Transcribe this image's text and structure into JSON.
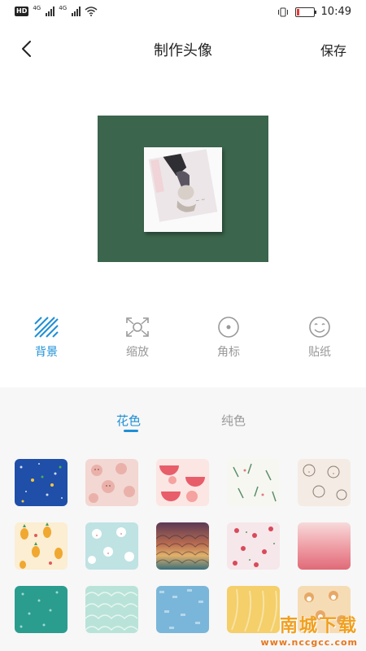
{
  "status_bar": {
    "hd_badge": "HD",
    "signal_1": "4G",
    "signal_2": "4G",
    "time": "10:49"
  },
  "header": {
    "title": "制作头像",
    "save_label": "保存"
  },
  "tools": [
    {
      "label": "背景",
      "icon": "background-stripes-icon",
      "active": true
    },
    {
      "label": "缩放",
      "icon": "scale-icon",
      "active": false
    },
    {
      "label": "角标",
      "icon": "badge-icon",
      "active": false
    },
    {
      "label": "贴纸",
      "icon": "sticker-icon",
      "active": false
    }
  ],
  "subtabs": [
    {
      "label": "花色",
      "active": true
    },
    {
      "label": "纯色",
      "active": false
    }
  ],
  "patterns": [
    {
      "name": "blue-star-pattern",
      "color": "#1f4fa8"
    },
    {
      "name": "pink-bear-pattern",
      "color": "#f3d7d2"
    },
    {
      "name": "watermelon-pattern",
      "color": "#f2c0bf"
    },
    {
      "name": "leaf-pattern",
      "color": "#f7f7f2"
    },
    {
      "name": "cat-doodle-pattern",
      "color": "#f4ece4"
    },
    {
      "name": "pineapple-pattern",
      "color": "#f5d8a3"
    },
    {
      "name": "mint-bunny-pattern",
      "color": "#bfe2e3"
    },
    {
      "name": "sunset-scale-pattern",
      "color": "#7a4a5c"
    },
    {
      "name": "strawberry-pattern",
      "color": "#f6e7ea"
    },
    {
      "name": "pink-gradient-pattern",
      "color": "#ee9aa2"
    },
    {
      "name": "teal-dot-pattern",
      "color": "#2a9d8f"
    },
    {
      "name": "mint-wave-pattern",
      "color": "#b9e3d8"
    },
    {
      "name": "blue-mosaic-pattern",
      "color": "#7ab6da"
    },
    {
      "name": "yellow-feather-pattern",
      "color": "#f4cf6a"
    },
    {
      "name": "shiba-pattern",
      "color": "#f6dcb5"
    }
  ],
  "watermark": {
    "big": "南城下载",
    "small": "www.nccgcc.com"
  },
  "accent_color": "#1e8fd6",
  "preview_bg_color": "#3b654c"
}
